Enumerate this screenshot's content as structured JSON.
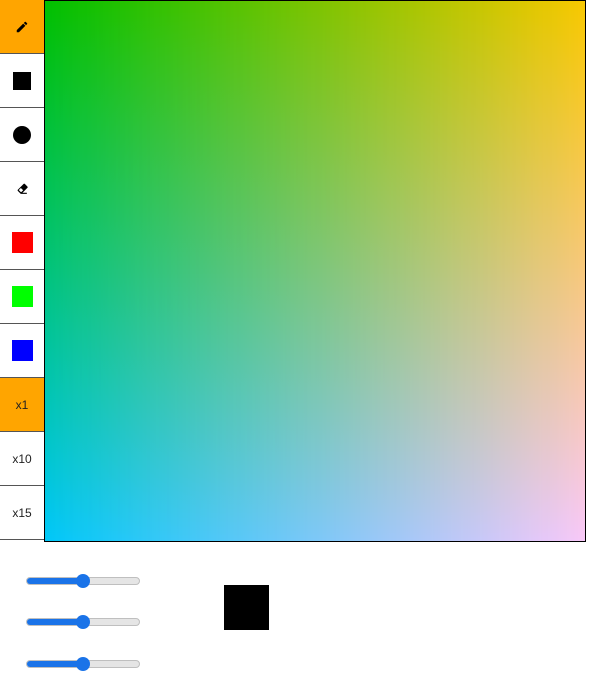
{
  "toolbar": {
    "tools": [
      {
        "name": "pencil",
        "icon": "pencil-icon",
        "active": true
      },
      {
        "name": "square",
        "icon": "square-icon",
        "active": false
      },
      {
        "name": "circle",
        "icon": "circle-icon",
        "active": false
      },
      {
        "name": "eraser",
        "icon": "eraser-icon",
        "active": false
      }
    ],
    "colors": [
      {
        "name": "red",
        "hex": "#ff0000"
      },
      {
        "name": "green",
        "hex": "#00ff00"
      },
      {
        "name": "blue",
        "hex": "#0000ff"
      }
    ],
    "sizes": [
      {
        "label": "x1",
        "active": true
      },
      {
        "label": "x10",
        "active": false
      },
      {
        "label": "x15",
        "active": false
      }
    ],
    "active_color": "#ffa500"
  },
  "canvas": {
    "corner_colors": {
      "top_left": "#00c000",
      "top_right": "#f8c800",
      "bottom_left": "#00c8f8",
      "bottom_right": "#f8c8f8"
    }
  },
  "sliders": [
    {
      "name": "red-slider",
      "value": 50
    },
    {
      "name": "green-slider",
      "value": 50
    },
    {
      "name": "blue-slider",
      "value": 50
    }
  ],
  "preview": {
    "color": "#000000"
  }
}
